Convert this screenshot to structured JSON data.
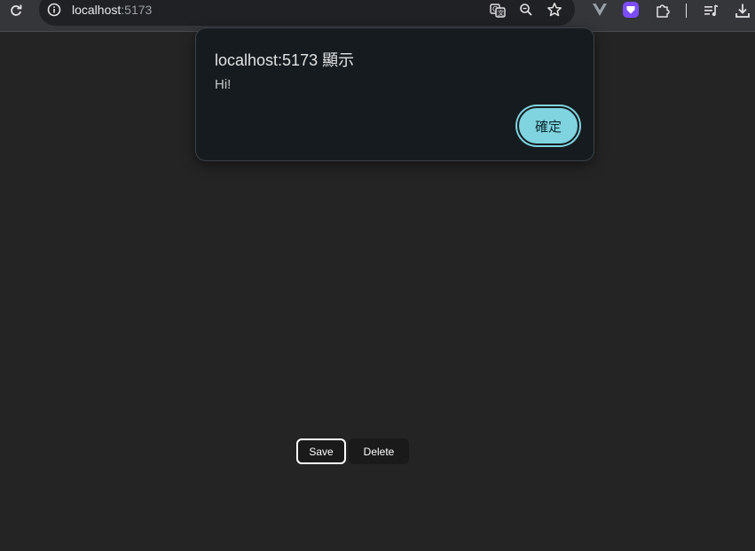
{
  "browser": {
    "url_host": "localhost",
    "url_port": ":5173",
    "icons": {
      "reload": "reload-icon",
      "site_info": "site-info-icon",
      "translate": "translate-icon",
      "zoom": "zoom-icon",
      "bookmark": "star-icon",
      "vue_devtools": "vue-devtools-icon",
      "extension": "purple-extension-icon",
      "extensions_menu": "puzzle-icon",
      "reading_list": "reading-list-icon",
      "downloads": "download-icon"
    }
  },
  "dialog": {
    "title": "localhost:5173 顯示",
    "message": "Hi!",
    "ok_label": "確定",
    "accent_color": "#7fd4e0"
  },
  "page": {
    "save_label": "Save",
    "delete_label": "Delete",
    "background": "#242424"
  }
}
